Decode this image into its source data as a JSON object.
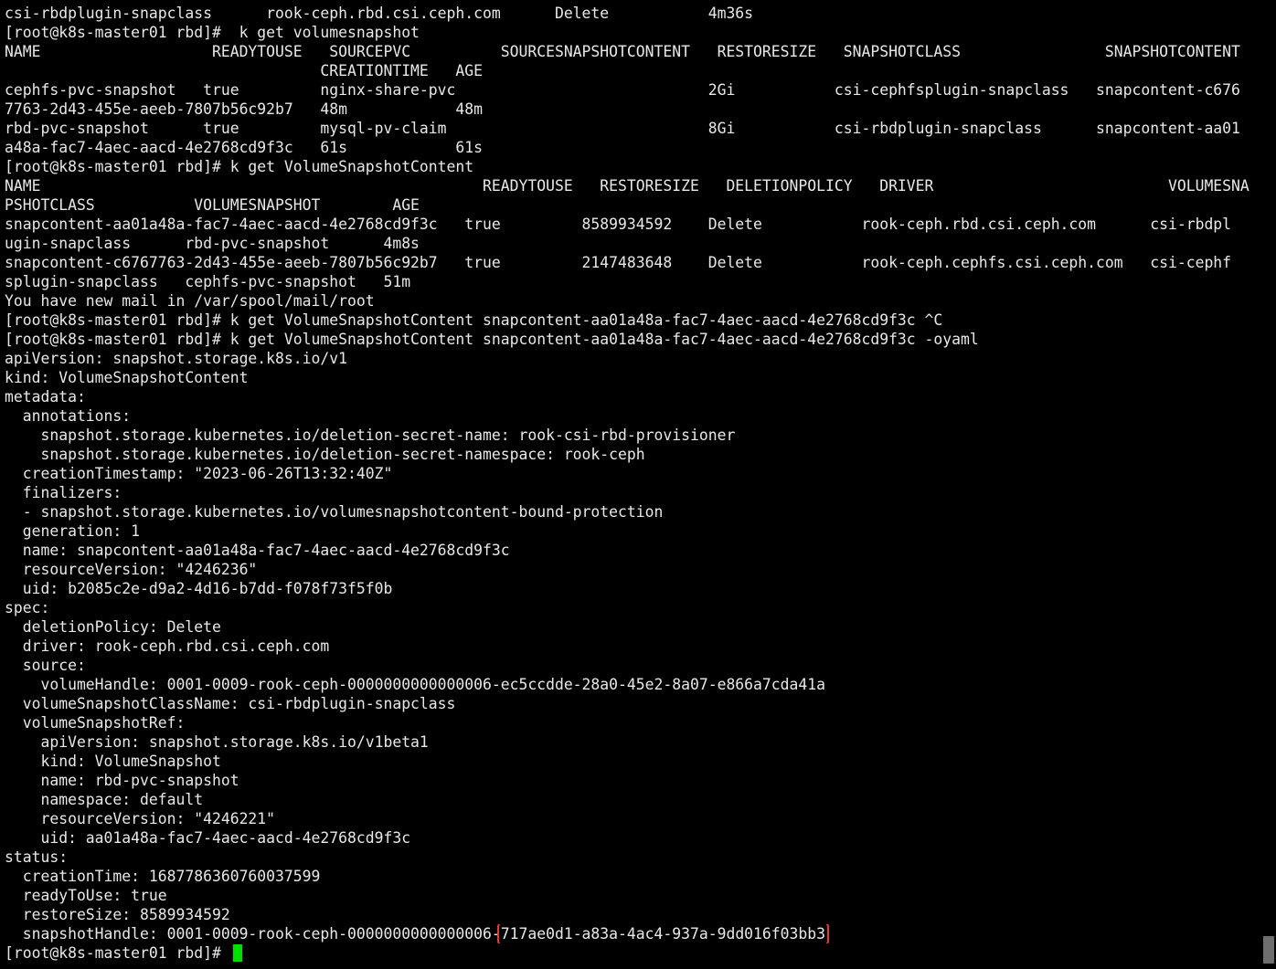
{
  "terminal": {
    "colors": {
      "background": "#000000",
      "foreground": "#e8e8e8",
      "highlight_box": "#e53935",
      "cursor": "#00e000"
    },
    "lines": [
      [
        {
          "t": "csi-rbdplugin-snapclass      rook-ceph.rbd.csi.ceph.com      Delete           4m36s"
        }
      ],
      [
        {
          "t": "[root@k8s-master01 rbd]#  k get volumesnapshot"
        }
      ],
      [
        {
          "t": "NAME                   READYTOUSE   SOURCEPVC          SOURCESNAPSHOTCONTENT   RESTORESIZE   SNAPSHOTCLASS                SNAPSHOTCONTENT"
        }
      ],
      [
        {
          "t": "                                   CREATIONTIME   AGE"
        }
      ],
      [
        {
          "t": "cephfs-pvc-snapshot   true         nginx-share-pvc                            2Gi           csi-cephfsplugin-snapclass   snapcontent-c676"
        }
      ],
      [
        {
          "t": "7763-2d43-455e-aeeb-7807b56c92b7   48m            48m"
        }
      ],
      [
        {
          "t": "rbd-pvc-snapshot      true         mysql-pv-claim                             8Gi           csi-rbdplugin-snapclass      snapcontent-aa01"
        }
      ],
      [
        {
          "t": "a48a-fac7-4aec-aacd-4e2768cd9f3c   61s            61s"
        }
      ],
      [
        {
          "t": "[root@k8s-master01 rbd]# k get VolumeSnapshotContent"
        }
      ],
      [
        {
          "t": "NAME                                                 READYTOUSE   RESTORESIZE   DELETIONPOLICY   DRIVER                          VOLUMESNA"
        }
      ],
      [
        {
          "t": "PSHOTCLASS           VOLUMESNAPSHOT        AGE"
        }
      ],
      [
        {
          "t": "snapcontent-aa01a48a-fac7-4aec-aacd-4e2768cd9f3c   true         8589934592    Delete           rook-ceph.rbd.csi.ceph.com      csi-rbdpl"
        }
      ],
      [
        {
          "t": "ugin-snapclass      rbd-pvc-snapshot      4m8s"
        }
      ],
      [
        {
          "t": "snapcontent-c6767763-2d43-455e-aeeb-7807b56c92b7   true         2147483648    Delete           rook-ceph.cephfs.csi.ceph.com   csi-cephf"
        }
      ],
      [
        {
          "t": "splugin-snapclass   cephfs-pvc-snapshot   51m"
        }
      ],
      [
        {
          "t": "You have new mail in /var/spool/mail/root"
        }
      ],
      [
        {
          "t": "[root@k8s-master01 rbd]# k get VolumeSnapshotContent snapcontent-aa01a48a-fac7-4aec-aacd-4e2768cd9f3c ^C"
        }
      ],
      [
        {
          "t": "[root@k8s-master01 rbd]# k get VolumeSnapshotContent snapcontent-aa01a48a-fac7-4aec-aacd-4e2768cd9f3c -oyaml"
        }
      ],
      [
        {
          "t": "apiVersion: snapshot.storage.k8s.io/v1"
        }
      ],
      [
        {
          "t": "kind: VolumeSnapshotContent"
        }
      ],
      [
        {
          "t": "metadata:"
        }
      ],
      [
        {
          "t": "  annotations:"
        }
      ],
      [
        {
          "t": "    snapshot.storage.kubernetes.io/deletion-secret-name: rook-csi-rbd-provisioner"
        }
      ],
      [
        {
          "t": "    snapshot.storage.kubernetes.io/deletion-secret-namespace: rook-ceph"
        }
      ],
      [
        {
          "t": "  creationTimestamp: \"2023-06-26T13:32:40Z\""
        }
      ],
      [
        {
          "t": "  finalizers:"
        }
      ],
      [
        {
          "t": "  - snapshot.storage.kubernetes.io/volumesnapshotcontent-bound-protection"
        }
      ],
      [
        {
          "t": "  generation: 1"
        }
      ],
      [
        {
          "t": "  name: snapcontent-aa01a48a-fac7-4aec-aacd-4e2768cd9f3c"
        }
      ],
      [
        {
          "t": "  resourceVersion: \"4246236\""
        }
      ],
      [
        {
          "t": "  uid: b2085c2e-d9a2-4d16-b7dd-f078f73f5f0b"
        }
      ],
      [
        {
          "t": "spec:"
        }
      ],
      [
        {
          "t": "  deletionPolicy: Delete"
        }
      ],
      [
        {
          "t": "  driver: rook-ceph.rbd.csi.ceph.com"
        }
      ],
      [
        {
          "t": "  source:"
        }
      ],
      [
        {
          "t": "    volumeHandle: 0001-0009-rook-ceph-0000000000000006-ec5ccdde-28a0-45e2-8a07-e866a7cda41a"
        }
      ],
      [
        {
          "t": "  volumeSnapshotClassName: csi-rbdplugin-snapclass"
        }
      ],
      [
        {
          "t": "  volumeSnapshotRef:"
        }
      ],
      [
        {
          "t": "    apiVersion: snapshot.storage.k8s.io/v1beta1"
        }
      ],
      [
        {
          "t": "    kind: VolumeSnapshot"
        }
      ],
      [
        {
          "t": "    name: rbd-pvc-snapshot"
        }
      ],
      [
        {
          "t": "    namespace: default"
        }
      ],
      [
        {
          "t": "    resourceVersion: \"4246221\""
        }
      ],
      [
        {
          "t": "    uid: aa01a48a-fac7-4aec-aacd-4e2768cd9f3c"
        }
      ],
      [
        {
          "t": "status:"
        }
      ],
      [
        {
          "t": "  creationTime: 1687786360760037599"
        }
      ],
      [
        {
          "t": "  readyToUse: true"
        }
      ],
      [
        {
          "t": "  restoreSize: 8589934592"
        }
      ],
      [
        {
          "t": "  snapshotHandle: 0001-0009-rook-ceph-0000000000000006-"
        },
        {
          "t": "717ae0d1-a83a-4ac4-937a-9dd016f03bb3",
          "highlight": true
        }
      ],
      [
        {
          "t": "[root@k8s-master01 rbd]# "
        },
        {
          "cursor": true
        }
      ]
    ]
  }
}
